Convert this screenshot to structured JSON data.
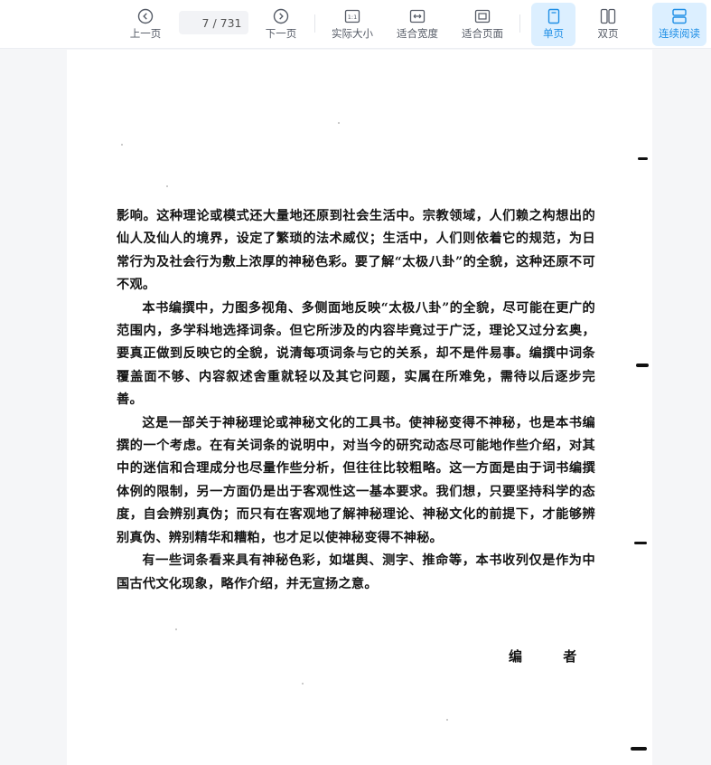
{
  "toolbar": {
    "prev_label": "上一页",
    "next_label": "下一页",
    "current_page": "7",
    "total_pages": "/ 731",
    "actual_size_label": "实际大小",
    "fit_width_label": "适合宽度",
    "fit_page_label": "适合页面",
    "single_page_label": "单页",
    "double_page_label": "双页",
    "continuous_label": "连续阅读",
    "actual_size_icon_text": "1:1"
  },
  "document": {
    "paragraphs": [
      "影响。这种理论或模式还大量地还原到社会生活中。宗教领域，人们赖之构想出的仙人及仙人的境界，设定了繁琐的法术威仪；生活中，人们则依着它的规范，为日常行为及社会行为敷上浓厚的神秘色彩。要了解“太极八卦”的全貌，这种还原不可不观。",
      "本书编撰中，力图多视角、多侧面地反映“太极八卦”的全貌，尽可能在更广的范围内，多学科地选择词条。但它所涉及的内容毕竟过于广泛，理论又过分玄奥，要真正做到反映它的全貌，说清每项词条与它的关系，却不是件易事。编撰中词条覆盖面不够、内容叙述舍重就轻以及其它问题，实属在所难免，需待以后逐步完善。",
      "这是一部关于神秘理论或神秘文化的工具书。使神秘变得不神秘，也是本书编撰的一个考虑。在有关词条的说明中，对当今的研究动态尽可能地作些介绍，对其中的迷信和合理成分也尽量作些分析，但往往比较粗略。这一方面是由于词书编撰体例的限制，另一方面仍是出于客观性这一基本要求。我们想，只要坚持科学的态度，自会辨别真伪；而只有在客观地了解神秘理论、神秘文化的前提下，才能够辨别真伪、辨别精华和糟粕，也才足以使神秘变得不神秘。",
      "有一些词条看来具有神秘色彩，如堪舆、测字、推命等，本书收列仅是作为中国古代文化现象，略作介绍，并无宣扬之意。"
    ],
    "signature": "编 者"
  },
  "colors": {
    "accent": "#1f8fe6",
    "active_bg": "#dcefff",
    "toolbar_bg": "#ffffff",
    "page_bg": "#ffffff",
    "viewer_bg": "#f5f6f8"
  }
}
